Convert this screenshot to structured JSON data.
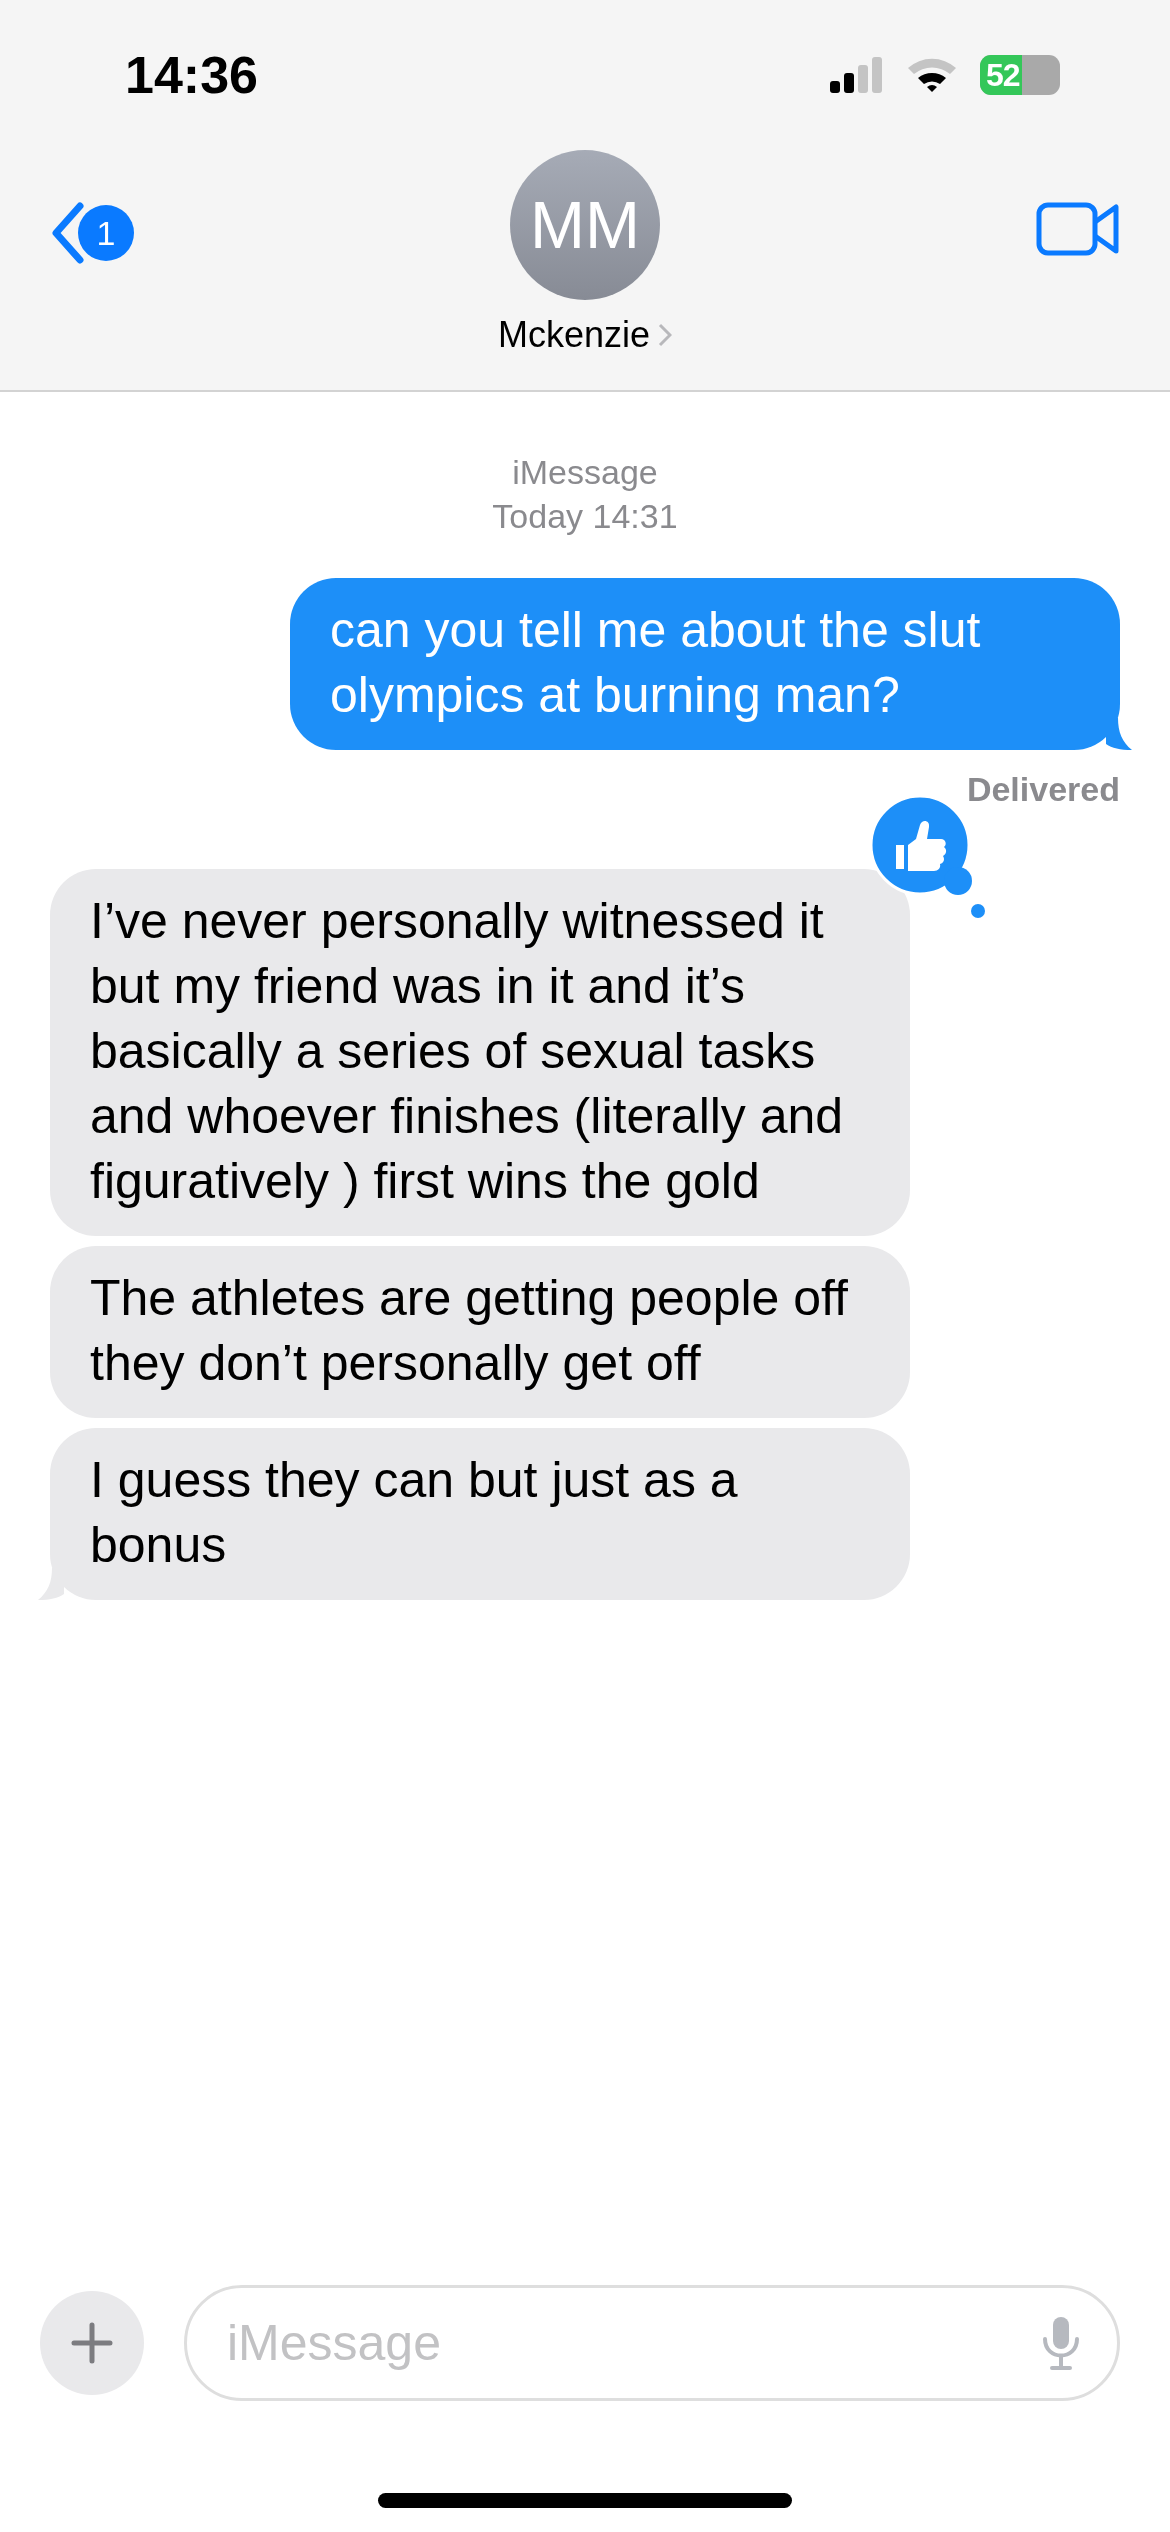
{
  "status_bar": {
    "time": "14:36",
    "battery": "52"
  },
  "header": {
    "back_badge": "1",
    "avatar_initials": "MM",
    "contact_name": "Mckenzie"
  },
  "thread": {
    "service": "iMessage",
    "timestamp": "Today 14:31"
  },
  "messages": [
    {
      "kind": "sent",
      "text": "can you tell me about the slut olympics at burning man?",
      "tail": true,
      "status": "Delivered"
    },
    {
      "kind": "received",
      "text": "I’ve never personally witnessed it but my friend was in it and it’s basically a series of sexual tasks and whoever finishes (literally and figuratively ) first wins the gold",
      "tail": false,
      "liked": true
    },
    {
      "kind": "received",
      "text": "The athletes are getting people off they don’t personally get off",
      "tail": false
    },
    {
      "kind": "received",
      "text": "I guess they can but just as a bonus",
      "tail": true
    }
  ],
  "composer": {
    "placeholder": "iMessage"
  }
}
